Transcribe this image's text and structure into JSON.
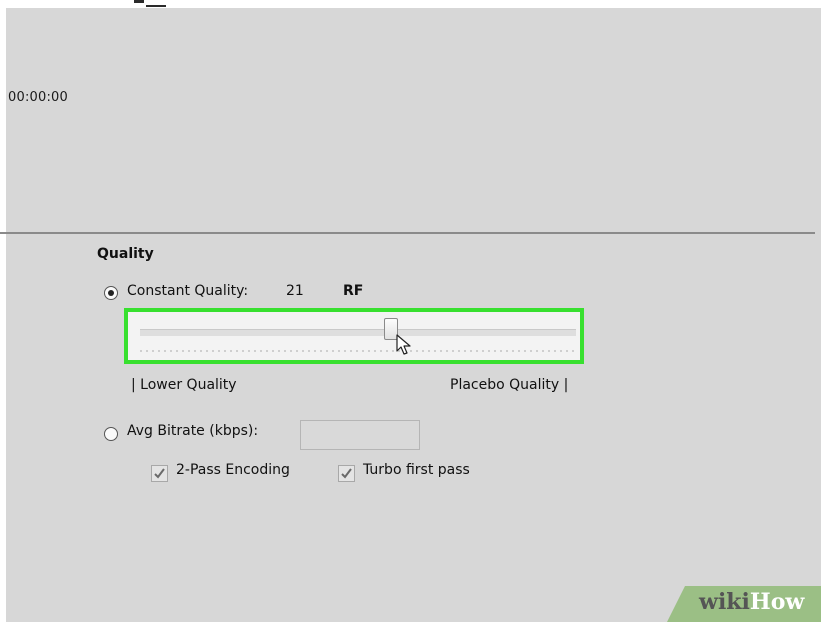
{
  "timeline": {
    "timecode": "00:00:00"
  },
  "quality": {
    "heading": "Quality",
    "mode_selected": "constant_quality",
    "constant_quality": {
      "label": "Constant Quality:",
      "value": "21",
      "unit": "RF",
      "slider_fraction": 0.58
    },
    "scale": {
      "low_label": "| Lower Quality",
      "high_label": "Placebo Quality |"
    },
    "avg_bitrate": {
      "label": "Avg Bitrate (kbps):",
      "value": "",
      "placeholder": ""
    },
    "two_pass": {
      "label": "2-Pass Encoding",
      "checked": true
    },
    "turbo": {
      "label": "Turbo first pass",
      "checked": true
    }
  },
  "highlight_color": "#38e02f",
  "watermark": {
    "wiki": "wiki",
    "how": "How"
  }
}
